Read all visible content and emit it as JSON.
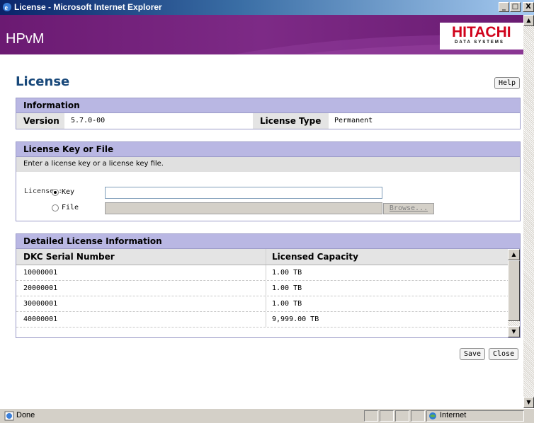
{
  "window": {
    "title": "License - Microsoft Internet Explorer",
    "minimize": "_",
    "maximize": "□",
    "close": "X"
  },
  "header": {
    "app_name": "HPvM",
    "logo_text": "HITACHI",
    "logo_subtext": "DATA SYSTEMS"
  },
  "page": {
    "title": "License",
    "help_label": "Help"
  },
  "information": {
    "heading": "Information",
    "version_label": "Version",
    "version_value": "5.7.0-00",
    "license_type_label": "License Type",
    "license_type_value": "Permanent"
  },
  "license_key": {
    "heading": "License Key or File",
    "description": "Enter a license key or a license key file.",
    "license_label": "License :",
    "key_label": "Key",
    "file_label": "File",
    "key_value": "",
    "file_value": "",
    "browse_label": "Browse...",
    "selected": "Key"
  },
  "detailed": {
    "heading": "Detailed License Information",
    "columns": [
      "DKC Serial Number",
      "Licensed Capacity"
    ],
    "rows": [
      [
        "10000001",
        "1.00 TB"
      ],
      [
        "20000001",
        "1.00 TB"
      ],
      [
        "30000001",
        "1.00 TB"
      ],
      [
        "40000001",
        "9,999.00 TB"
      ]
    ]
  },
  "actions": {
    "save_label": "Save",
    "close_label": "Close"
  },
  "statusbar": {
    "status_text": "Done",
    "zone_text": "Internet"
  },
  "colors": {
    "banner": "#7d2a86",
    "panel_header": "#b9b7e3",
    "title_text": "#18487a",
    "logo_red": "#d0021b"
  }
}
